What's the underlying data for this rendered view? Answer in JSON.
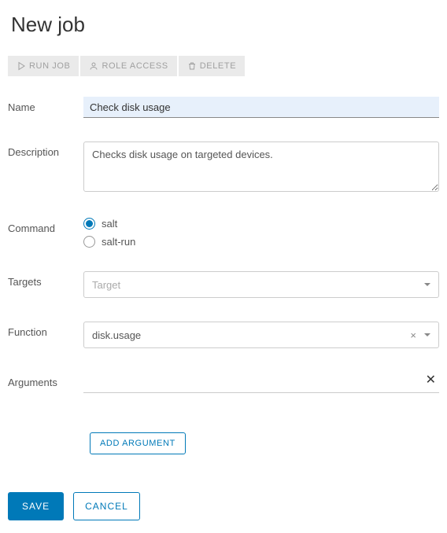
{
  "page": {
    "title": "New job"
  },
  "toolbar": {
    "run_label": "RUN JOB",
    "role_label": "ROLE ACCESS",
    "delete_label": "DELETE"
  },
  "form": {
    "name_label": "Name",
    "name_value": "Check disk usage",
    "desc_label": "Description",
    "desc_value": "Checks disk usage on targeted devices.",
    "command_label": "Command",
    "command_options": {
      "salt": "salt",
      "salt_run": "salt-run"
    },
    "command_selected": "salt",
    "targets_label": "Targets",
    "targets_placeholder": "Target",
    "function_label": "Function",
    "function_value": "disk.usage",
    "arguments_label": "Arguments",
    "add_argument_label": "ADD ARGUMENT"
  },
  "footer": {
    "save_label": "SAVE",
    "cancel_label": "CANCEL"
  }
}
